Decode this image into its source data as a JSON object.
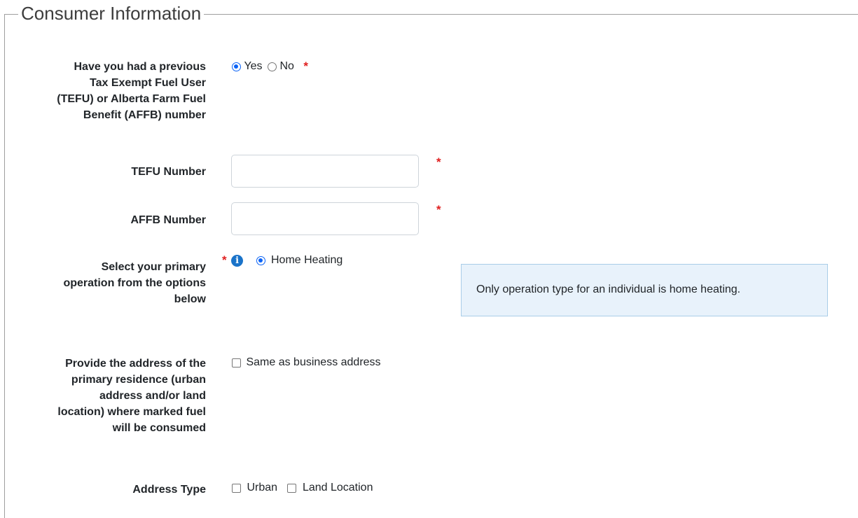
{
  "section": {
    "title": "Consumer Information"
  },
  "required_marker": "*",
  "previous_number": {
    "label": "Have you had a previous Tax Exempt Fuel User (TEFU) or Alberta Farm Fuel Benefit (AFFB) number",
    "label_lines": [
      "Have you had a previous",
      "Tax Exempt Fuel User",
      "(TEFU) or Alberta Farm Fuel",
      "Benefit (AFFB) number"
    ],
    "options": [
      {
        "label": "Yes",
        "checked": true
      },
      {
        "label": "No",
        "checked": false
      }
    ]
  },
  "tefu": {
    "label": "TEFU Number",
    "value": ""
  },
  "affb": {
    "label": "AFFB Number",
    "value": ""
  },
  "operation": {
    "label_lines": [
      "Select your primary",
      "operation from the options",
      "below"
    ],
    "info_icon": "info-icon",
    "options": [
      {
        "label": "Home Heating",
        "checked": true
      }
    ],
    "info_text": "Only operation type for an individual is home heating."
  },
  "residence": {
    "label_lines": [
      "Provide the address of the",
      "primary residence (urban",
      "address and/or land",
      "location) where marked fuel",
      "will be consumed"
    ],
    "same_as_business": {
      "label": "Same as business address",
      "checked": false
    }
  },
  "address_type": {
    "label": "Address Type",
    "options": [
      {
        "label": "Urban",
        "checked": false
      },
      {
        "label": "Land Location",
        "checked": false
      }
    ]
  },
  "colors": {
    "accent": "#0b63f6",
    "required": "#e02020",
    "info_bg": "#e8f2fb",
    "info_border": "#a9cde8"
  }
}
